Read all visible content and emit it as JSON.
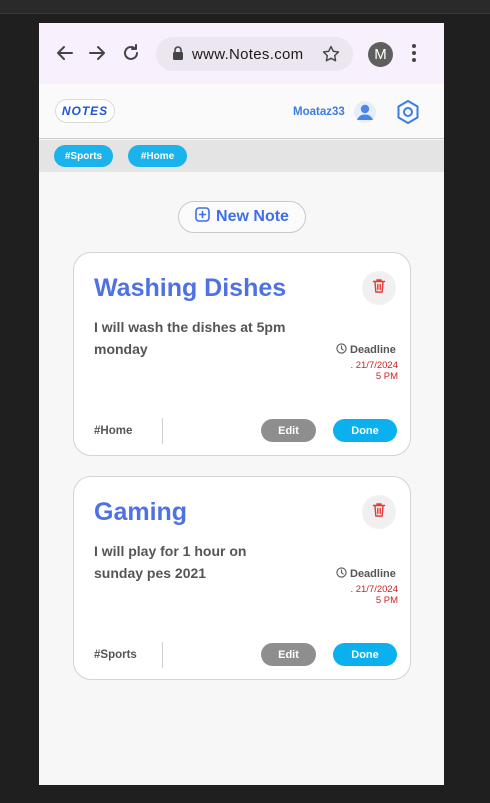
{
  "browser": {
    "url": "www.Notes.com",
    "profile_initial": "M"
  },
  "header": {
    "logo": "NOTES",
    "username": "Moataz33"
  },
  "tags": [
    {
      "label": "#Sports"
    },
    {
      "label": "#Home"
    }
  ],
  "new_note": {
    "label": "New Note"
  },
  "notes": [
    {
      "title": "Washing Dishes",
      "description": "I will wash the dishes at 5pm monday",
      "deadline_label": "Deadline",
      "deadline_date": ". 21/7/2024",
      "deadline_time": "5 PM",
      "tag": "#Home",
      "edit_label": "Edit",
      "done_label": "Done"
    },
    {
      "title": "Gaming",
      "description": "I will play for 1 hour on sunday pes 2021",
      "deadline_label": "Deadline",
      "deadline_date": ". 21/7/2024",
      "deadline_time": "5 PM",
      "tag": "#Sports",
      "edit_label": "Edit",
      "done_label": "Done"
    }
  ],
  "colors": {
    "accent_blue": "#4f72e3",
    "chip_cyan": "#1ab3ec",
    "deadline_red": "#d02020",
    "edit_gray": "#8e8e8e"
  }
}
